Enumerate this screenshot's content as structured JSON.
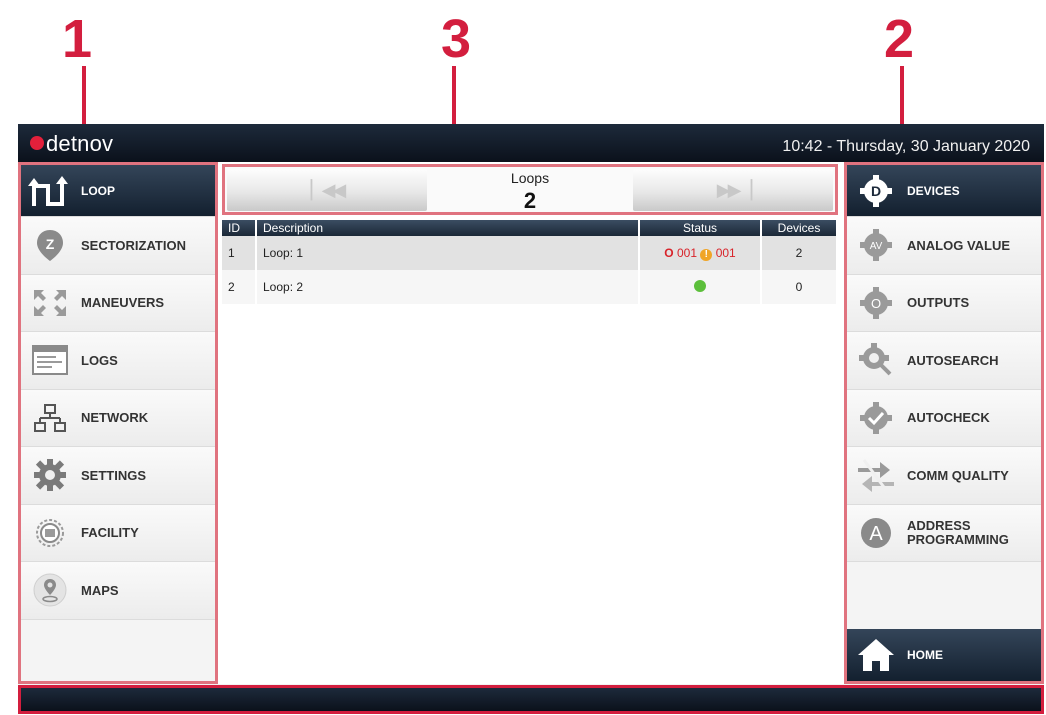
{
  "annotations": {
    "left_nav_number": "1",
    "right_nav_number": "2",
    "pager_number": "3",
    "color": "#d31e3e"
  },
  "header": {
    "logo_text": "detnov",
    "clock": "10:42  -  Thursday, 30 January 2020"
  },
  "left_nav": {
    "items": [
      {
        "label": "LOOP",
        "icon": "loop-icon",
        "active": true
      },
      {
        "label": "SECTORIZATION",
        "icon": "sectorization-z-icon"
      },
      {
        "label": "MANEUVERS",
        "icon": "maneuvers-arrows-icon"
      },
      {
        "label": "LOGS",
        "icon": "logs-window-icon"
      },
      {
        "label": "NETWORK",
        "icon": "network-icon"
      },
      {
        "label": "SETTINGS",
        "icon": "gear-icon"
      },
      {
        "label": "FACILITY",
        "icon": "facility-icon"
      },
      {
        "label": "MAPS",
        "icon": "map-pin-icon"
      }
    ]
  },
  "pager": {
    "title": "Loops",
    "count": "2",
    "prev_icon": "skip-first-icon",
    "next_icon": "skip-last-icon"
  },
  "table": {
    "headers": [
      "ID",
      "Description",
      "Status",
      "Devices"
    ],
    "rows": [
      {
        "id": "1",
        "description": "Loop: 1",
        "status_alarm": "001",
        "status_fault": "001",
        "devices": "2"
      },
      {
        "id": "2",
        "description": "Loop: 2",
        "status": "ok-green",
        "devices": "0"
      }
    ]
  },
  "right_nav": {
    "items": [
      {
        "label": "DEVICES",
        "icon": "devices-gear-d-icon",
        "active": true
      },
      {
        "label": "ANALOG VALUE",
        "icon": "analog-value-gear-icon"
      },
      {
        "label": "OUTPUTS",
        "icon": "outputs-gear-icon"
      },
      {
        "label": "AUTOSEARCH",
        "icon": "autosearch-gear-icon"
      },
      {
        "label": "AUTOCHECK",
        "icon": "autocheck-gear-icon"
      },
      {
        "label": "COMM QUALITY",
        "icon": "comm-quality-arrows-icon"
      },
      {
        "label": "ADDRESS PROGRAMMING",
        "icon": "address-programming-icon"
      }
    ],
    "home_label": "HOME"
  },
  "colors": {
    "brand_red": "#e3203b",
    "active_nav": "#1d2a3b",
    "status_ok": "#5cbf3b",
    "status_alarm": "#d8232a"
  }
}
